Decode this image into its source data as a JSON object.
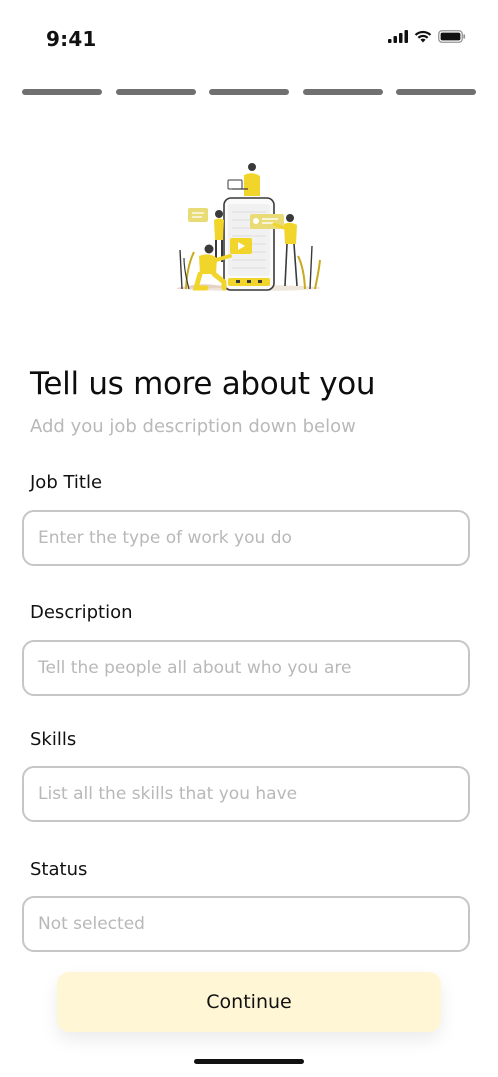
{
  "status_bar": {
    "time": "9:41"
  },
  "progress": {
    "total_steps": 5
  },
  "page": {
    "title": "Tell us more about you",
    "subtitle": "Add you job description down below"
  },
  "form": {
    "job_title": {
      "label": "Job Title",
      "placeholder": "Enter the type of work you do",
      "value": ""
    },
    "description": {
      "label": "Description",
      "placeholder": "Tell the people all about who you are",
      "value": ""
    },
    "skills": {
      "label": "Skills",
      "placeholder": "List all the skills that you have",
      "value": ""
    },
    "status": {
      "label": "Status",
      "value": "Not selected"
    }
  },
  "actions": {
    "continue_label": "Continue"
  },
  "colors": {
    "accent": "#F2D52B",
    "button_bg": "#FFF6D6",
    "progress": "#707070",
    "placeholder": "#B8B8B8"
  }
}
